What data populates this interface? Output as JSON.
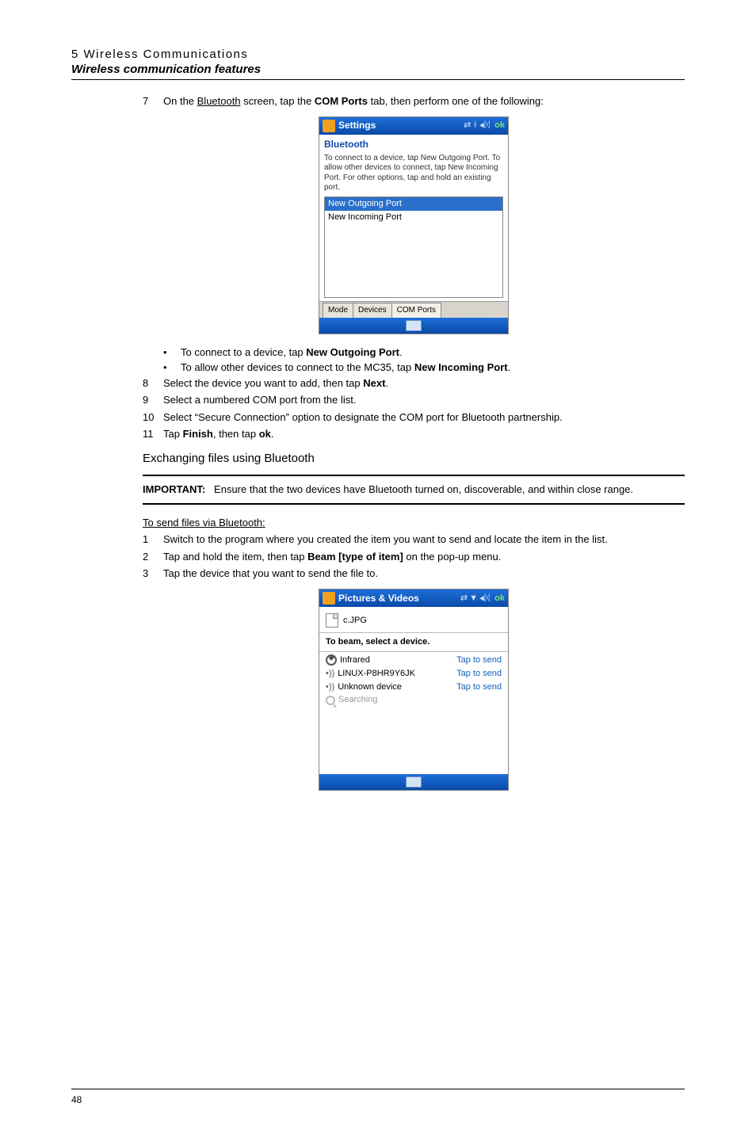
{
  "header": {
    "breadcrumb": "5 Wireless Communications",
    "title": "Wireless communication features"
  },
  "step7": {
    "num": "7",
    "pre": "On the ",
    "link": "Bluetooth",
    "mid": " screen, tap the ",
    "bold": "COM Ports",
    "post": " tab, then perform one of the following:"
  },
  "mock1": {
    "title": "Settings",
    "ok": "ok",
    "subtitle": "Bluetooth",
    "desc": "To connect to a device, tap New Outgoing Port. To allow other devices to connect, tap New Incoming Port. For other options, tap and hold an existing port.",
    "list": {
      "selected": "New Outgoing Port",
      "item2": "New Incoming Port"
    },
    "tabs": {
      "mode": "Mode",
      "devices": "Devices",
      "com": "COM Ports"
    }
  },
  "bullets": {
    "b1_pre": "To connect to a device, tap ",
    "b1_bold": "New Outgoing Port",
    "b1_post": ".",
    "b2_pre": "To allow other devices to connect to the MC35, tap ",
    "b2_bold": "New Incoming Port",
    "b2_post": "."
  },
  "step8": {
    "num": "8",
    "pre": "Select the device you want to add, then tap ",
    "bold": "Next",
    "post": "."
  },
  "step9": {
    "num": "9",
    "text": "Select a numbered COM port from the list."
  },
  "step10": {
    "num": "10",
    "text": "Select “Secure Connection” option to designate the COM port for Bluetooth partnership."
  },
  "step11": {
    "num": "11",
    "pre": "Tap ",
    "bold1": "Finish",
    "mid": ", then tap ",
    "bold2": "ok",
    "post": "."
  },
  "section_sub": "Exchanging files using Bluetooth",
  "important": {
    "label": "IMPORTANT:",
    "text": "Ensure that the two devices have Bluetooth turned on, discoverable, and within close range."
  },
  "send_heading": "To send files via Bluetooth:",
  "send1": {
    "num": "1",
    "text": "Switch to the program where you created the item you want to send and locate the item in the list."
  },
  "send2": {
    "num": "2",
    "pre": "Tap and hold the item, then tap ",
    "bold": "Beam [type of item]",
    "post": " on the pop-up menu."
  },
  "send3": {
    "num": "3",
    "text": "Tap the device that you want to send the file to."
  },
  "mock2": {
    "title": "Pictures & Videos",
    "ok": "ok",
    "file": "c.JPG",
    "caption": "To beam, select a device.",
    "rows": [
      {
        "name": "Infrared",
        "status": "Tap to send",
        "type": "ir"
      },
      {
        "name": "LINUX-P8HR9Y6JK",
        "status": "Tap to send",
        "type": "bt"
      },
      {
        "name": "Unknown device",
        "status": "Tap to send",
        "type": "bt"
      },
      {
        "name": "Searching",
        "status": "",
        "type": "search"
      }
    ]
  },
  "page_number": "48"
}
